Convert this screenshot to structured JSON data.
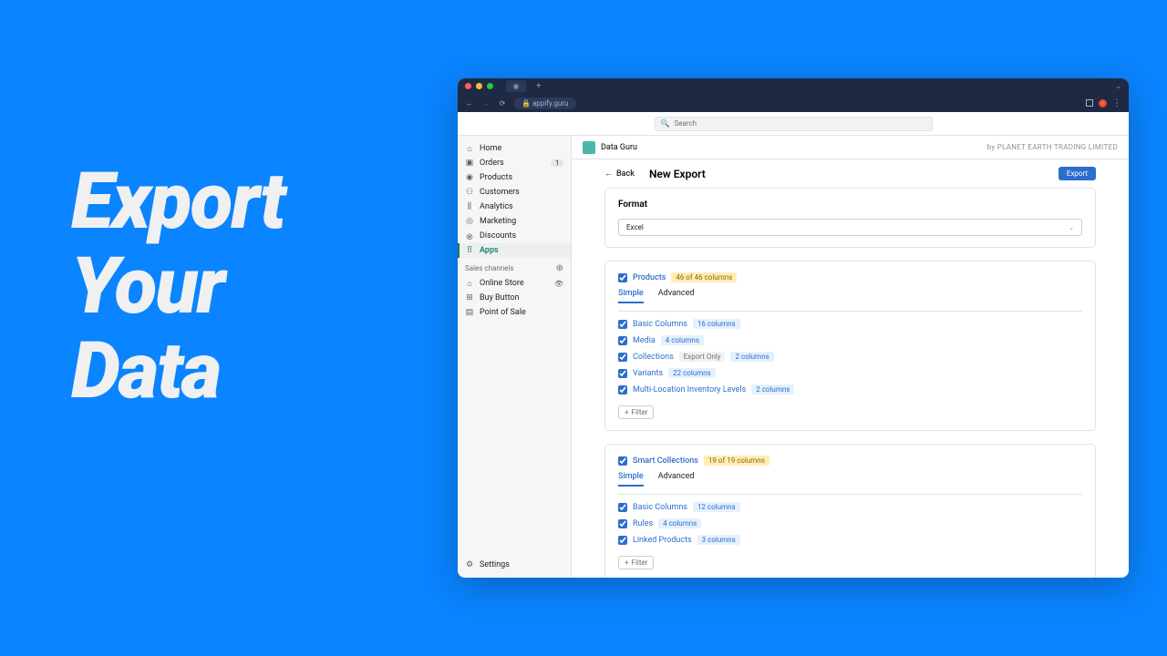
{
  "hero": "Export\nYour\nData",
  "browser": {
    "url": "appify.guru"
  },
  "search_placeholder": "Search",
  "sidebar": {
    "items": [
      {
        "label": "Home",
        "icon": "⌂"
      },
      {
        "label": "Orders",
        "icon": "▣",
        "badge": "1"
      },
      {
        "label": "Products",
        "icon": "◉"
      },
      {
        "label": "Customers",
        "icon": "⚇"
      },
      {
        "label": "Analytics",
        "icon": "⫼"
      },
      {
        "label": "Marketing",
        "icon": "◎"
      },
      {
        "label": "Discounts",
        "icon": "֎"
      },
      {
        "label": "Apps",
        "icon": "⠿",
        "active": true
      }
    ],
    "sales_channels_label": "Sales channels",
    "channels": [
      {
        "label": "Online Store",
        "icon": "⌂",
        "eye": true
      },
      {
        "label": "Buy Button",
        "icon": "⊞"
      },
      {
        "label": "Point of Sale",
        "icon": "▤"
      }
    ],
    "settings_label": "Settings"
  },
  "app_header": {
    "name": "Data Guru",
    "byline": "by PLANET EARTH TRADING LIMITED"
  },
  "page": {
    "back_label": "Back",
    "title": "New Export",
    "export_label": "Export"
  },
  "format_card": {
    "title": "Format",
    "value": "Excel"
  },
  "sections": [
    {
      "title": "Products",
      "count_badge": "46 of 46 columns",
      "tabs": [
        "Simple",
        "Advanced"
      ],
      "active_tab": "Simple",
      "rows": [
        {
          "name": "Basic Columns",
          "badges": [
            {
              "text": "16 columns",
              "type": "blue"
            }
          ]
        },
        {
          "name": "Media",
          "badges": [
            {
              "text": "4 columns",
              "type": "blue"
            }
          ]
        },
        {
          "name": "Collections",
          "badges": [
            {
              "text": "Export Only",
              "type": "gray"
            },
            {
              "text": "2 columns",
              "type": "blue"
            }
          ]
        },
        {
          "name": "Variants",
          "badges": [
            {
              "text": "22 columns",
              "type": "blue"
            }
          ]
        },
        {
          "name": "Multi-Location Inventory Levels",
          "badges": [
            {
              "text": "2 columns",
              "type": "blue"
            }
          ]
        }
      ],
      "filter_label": "Filter"
    },
    {
      "title": "Smart Collections",
      "count_badge": "19 of 19 columns",
      "tabs": [
        "Simple",
        "Advanced"
      ],
      "active_tab": "Simple",
      "rows": [
        {
          "name": "Basic Columns",
          "badges": [
            {
              "text": "12 columns",
              "type": "blue"
            }
          ]
        },
        {
          "name": "Rules",
          "badges": [
            {
              "text": "4 columns",
              "type": "blue"
            }
          ]
        },
        {
          "name": "Linked Products",
          "badges": [
            {
              "text": "3 columns",
              "type": "blue"
            }
          ]
        }
      ],
      "filter_label": "Filter"
    }
  ]
}
